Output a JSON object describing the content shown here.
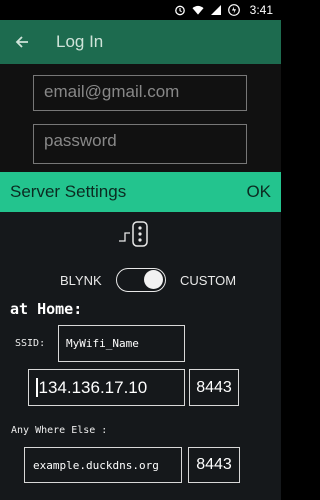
{
  "status_bar": {
    "time": "3:41",
    "icons": [
      "alarm-icon",
      "wifi-icon",
      "cell-signal-icon",
      "battery-icon"
    ]
  },
  "app_bar": {
    "back_icon": "arrow-left-icon",
    "title": "Log In",
    "color": "#1d6b4f"
  },
  "login": {
    "email_placeholder": "email@gmail.com",
    "password_placeholder": "password"
  },
  "dialog": {
    "title": "Server Settings",
    "ok_label": "OK",
    "accent": "#23c48e",
    "server_icon": "server-switch-icon",
    "toggle": {
      "left_label": "BLYNK",
      "right_label": "CUSTOM",
      "state": "CUSTOM"
    },
    "home": {
      "heading": "at Home:",
      "ssid_label": "SSID:",
      "ssid_value": "MyWifi_Name",
      "ip_value": "134.136.17.10",
      "port_value": "8443"
    },
    "elsewhere": {
      "heading": "Any Where Else :",
      "domain_value": "example.duckdns.org",
      "port_value": "8443"
    }
  }
}
